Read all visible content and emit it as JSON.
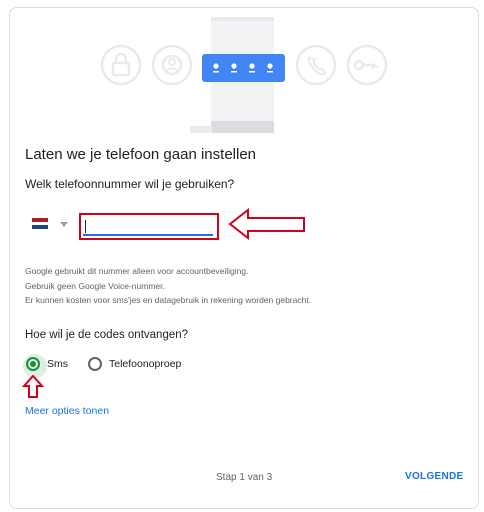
{
  "title": "Laten we je telefoon gaan instellen",
  "phone_question": "Welk telefoonnummer wil je gebruiken?",
  "country": {
    "flag": "netherlands-flag",
    "colors": [
      "#ae1c28",
      "#ffffff",
      "#21468b"
    ]
  },
  "phone_input": {
    "value": "",
    "placeholder": ""
  },
  "info_lines": [
    "Google gebruikt dit nummer alleen voor accountbeveiliging.",
    "Gebruik geen Google Voice-nummer.",
    "Er kunnen kosten voor sms'jes en datagebruik in rekening worden gebracht."
  ],
  "codes_question": "Hoe wil je de codes ontvangen?",
  "options": [
    {
      "label": "Sms",
      "selected": true
    },
    {
      "label": "Telefoonoproep",
      "selected": false
    }
  ],
  "more_options_link": "Meer opties tonen",
  "step_text": "Stap 1 van 3",
  "next_button": "VOLGENDE",
  "colors": {
    "accent": "#1a73e8",
    "radio": "#1e8e3e",
    "highlight": "#d0021b"
  },
  "hero_icons": [
    "lock-icon",
    "account-icon",
    "password-dots-icon",
    "phone-call-icon",
    "key-icon"
  ]
}
